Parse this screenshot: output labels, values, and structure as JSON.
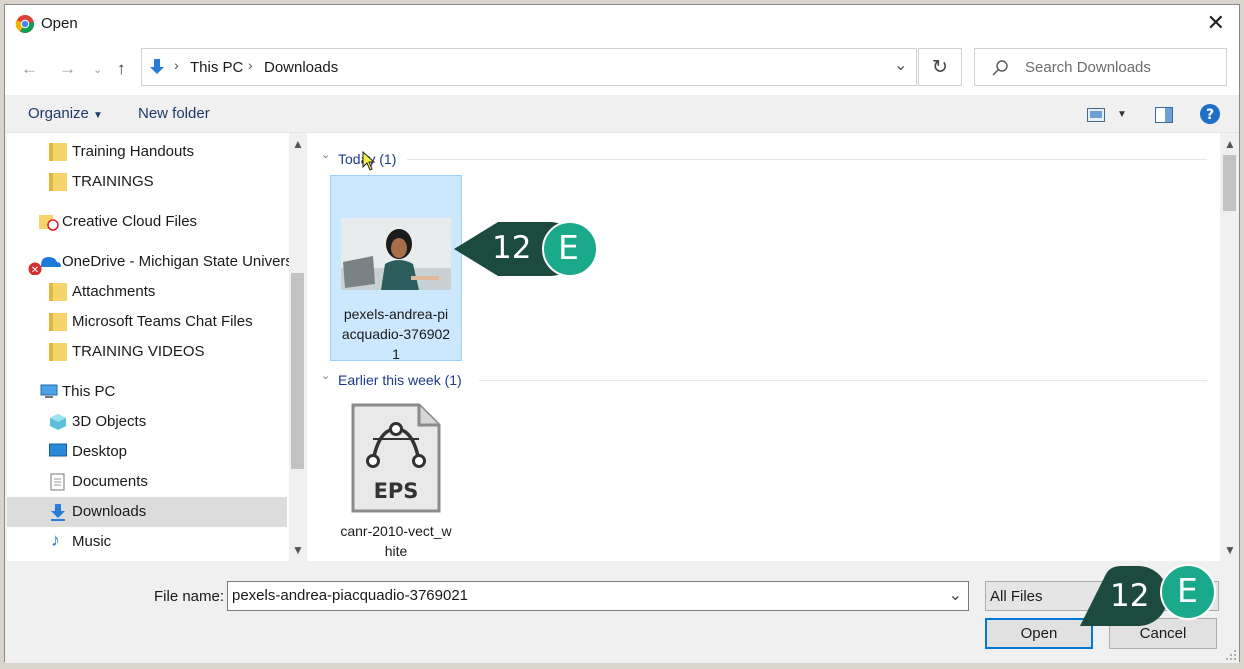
{
  "window": {
    "title": "Open"
  },
  "address": {
    "segments": [
      "This PC",
      "Downloads"
    ]
  },
  "search": {
    "placeholder": "Search Downloads"
  },
  "toolbar": {
    "organize": "Organize",
    "new_folder": "New folder"
  },
  "nav": {
    "items": [
      {
        "label": "Training Handouts"
      },
      {
        "label": "TRAININGS"
      },
      {
        "label": "Creative Cloud Files"
      },
      {
        "label": "OneDrive - Michigan State Univers"
      },
      {
        "label": "Attachments"
      },
      {
        "label": "Microsoft Teams Chat Files"
      },
      {
        "label": "TRAINING VIDEOS"
      },
      {
        "label": "This PC"
      },
      {
        "label": "3D Objects"
      },
      {
        "label": "Desktop"
      },
      {
        "label": "Documents"
      },
      {
        "label": "Downloads"
      },
      {
        "label": "Music"
      }
    ],
    "selected": "Downloads"
  },
  "groups": [
    {
      "header": "Today (1)",
      "files": [
        {
          "name_lines": [
            "pexels-andrea-pi",
            "acquadio-376902",
            "1"
          ],
          "kind": "image"
        }
      ]
    },
    {
      "header": "Earlier this week (1)",
      "files": [
        {
          "name_lines": [
            "canr-2010-vect_w",
            "hite"
          ],
          "kind": "eps",
          "badge": "EPS"
        }
      ]
    }
  ],
  "footer": {
    "file_name_label": "File name:",
    "file_name_value": "pexels-andrea-piacquadio-3769021",
    "file_type": "All Files",
    "open": "Open",
    "cancel": "Cancel"
  },
  "callouts": [
    {
      "number": "12",
      "letter": "E"
    },
    {
      "number": "12",
      "letter": "E"
    }
  ],
  "colors": {
    "callout_dark": "#1c4a3e",
    "callout_accent": "#1aa98a",
    "selection": "#cce8ff",
    "focus": "#0078d7"
  }
}
